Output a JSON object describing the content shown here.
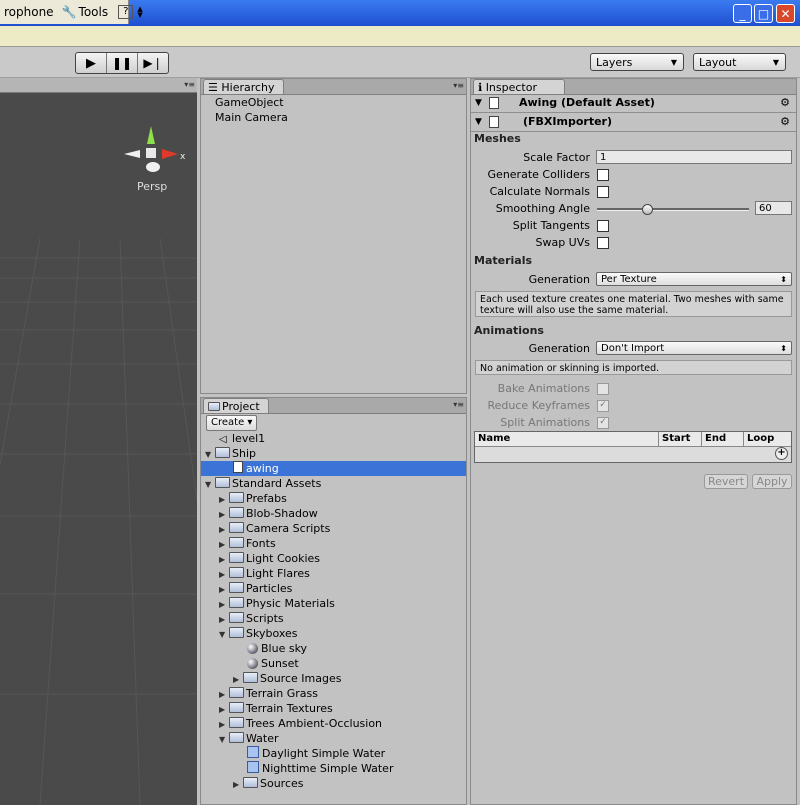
{
  "menubar": {
    "items": [
      "rophone",
      "Tools",
      "?"
    ]
  },
  "window_buttons": [
    "_",
    "□",
    "✕"
  ],
  "toolbar": {
    "layers_label": "Layers",
    "layout_label": "Layout"
  },
  "scene": {
    "persp_label": "Persp",
    "axis_x": "x"
  },
  "hierarchy": {
    "tab_label": "Hierarchy",
    "items": [
      "GameObject",
      "Main Camera"
    ]
  },
  "project": {
    "tab_label": "Project",
    "create_label": "Create ▾",
    "items": [
      {
        "label": "level1",
        "icon": "unity-icon",
        "depth": 1,
        "arrow": ""
      },
      {
        "label": "Ship",
        "icon": "folder-icon",
        "depth": 0,
        "arrow": "▼"
      },
      {
        "label": "awing",
        "icon": "document-icon",
        "depth": 2,
        "arrow": "",
        "selected": true
      },
      {
        "label": "Standard Assets",
        "icon": "folder-icon",
        "depth": 0,
        "arrow": "▼"
      },
      {
        "label": "Prefabs",
        "icon": "folder-icon",
        "depth": 1,
        "arrow": "▶"
      },
      {
        "label": "Blob-Shadow",
        "icon": "folder-icon",
        "depth": 1,
        "arrow": "▶"
      },
      {
        "label": "Camera Scripts",
        "icon": "folder-icon",
        "depth": 1,
        "arrow": "▶"
      },
      {
        "label": "Fonts",
        "icon": "folder-icon",
        "depth": 1,
        "arrow": "▶"
      },
      {
        "label": "Light Cookies",
        "icon": "folder-icon",
        "depth": 1,
        "arrow": "▶"
      },
      {
        "label": "Light Flares",
        "icon": "folder-icon",
        "depth": 1,
        "arrow": "▶"
      },
      {
        "label": "Particles",
        "icon": "folder-icon",
        "depth": 1,
        "arrow": "▶"
      },
      {
        "label": "Physic Materials",
        "icon": "folder-icon",
        "depth": 1,
        "arrow": "▶"
      },
      {
        "label": "Scripts",
        "icon": "folder-icon",
        "depth": 1,
        "arrow": "▶"
      },
      {
        "label": "Skyboxes",
        "icon": "folder-icon",
        "depth": 1,
        "arrow": "▼"
      },
      {
        "label": "Blue sky",
        "icon": "sphere-icon",
        "depth": 3,
        "arrow": ""
      },
      {
        "label": "Sunset",
        "icon": "sphere-icon",
        "depth": 3,
        "arrow": ""
      },
      {
        "label": "Source Images",
        "icon": "folder-icon",
        "depth": 2,
        "arrow": "▶"
      },
      {
        "label": "Terrain Grass",
        "icon": "folder-icon",
        "depth": 1,
        "arrow": "▶"
      },
      {
        "label": "Terrain Textures",
        "icon": "folder-icon",
        "depth": 1,
        "arrow": "▶"
      },
      {
        "label": "Trees Ambient-Occlusion",
        "icon": "folder-icon",
        "depth": 1,
        "arrow": "▶"
      },
      {
        "label": "Water",
        "icon": "folder-icon",
        "depth": 1,
        "arrow": "▼"
      },
      {
        "label": "Daylight Simple Water",
        "icon": "prefab-icon",
        "depth": 3,
        "arrow": ""
      },
      {
        "label": "Nighttime Simple Water",
        "icon": "prefab-icon",
        "depth": 3,
        "arrow": ""
      },
      {
        "label": "Sources",
        "icon": "folder-icon",
        "depth": 2,
        "arrow": "▶"
      }
    ]
  },
  "inspector": {
    "tab_label": "Inspector",
    "asset_title": "Awing (Default Asset)",
    "importer_title": "(FBXImporter)",
    "meshes": {
      "header": "Meshes",
      "scale_factor_label": "Scale Factor",
      "scale_factor_value": "1",
      "generate_colliders_label": "Generate Colliders",
      "calculate_normals_label": "Calculate Normals",
      "smoothing_angle_label": "Smoothing Angle",
      "smoothing_angle_value": "60",
      "smoothing_angle_fraction": 0.33,
      "split_tangents_label": "Split Tangents",
      "swap_uvs_label": "Swap UVs"
    },
    "materials": {
      "header": "Materials",
      "generation_label": "Generation",
      "generation_value": "Per Texture",
      "help": "Each used texture creates one material. Two meshes with same texture will also use the same material."
    },
    "animations": {
      "header": "Animations",
      "generation_label": "Generation",
      "generation_value": "Don't Import",
      "help": "No animation or skinning is imported.",
      "bake_label": "Bake Animations",
      "reduce_label": "Reduce Keyframes",
      "split_label": "Split Animations",
      "table_headers": [
        "Name",
        "Start",
        "End",
        "Loop"
      ]
    },
    "revert_label": "Revert",
    "apply_label": "Apply"
  }
}
